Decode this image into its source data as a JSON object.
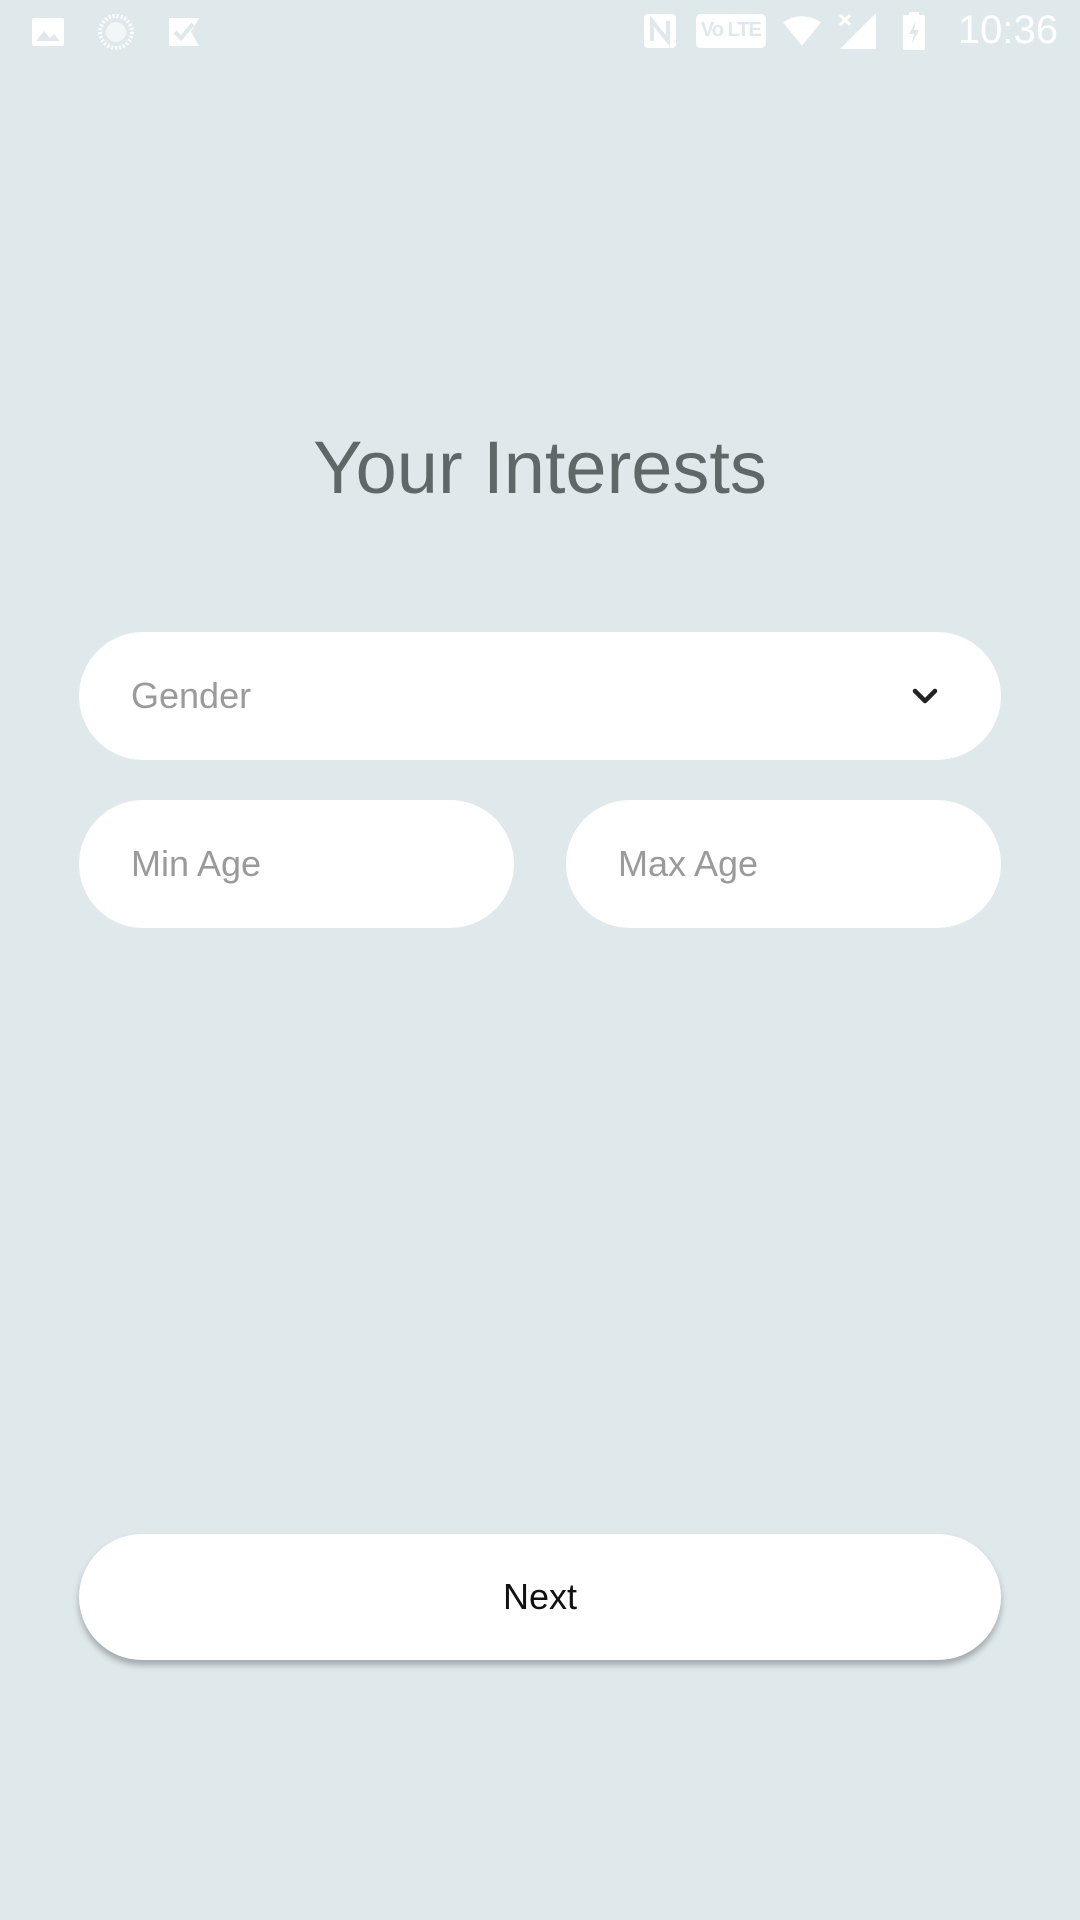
{
  "status_bar": {
    "time": "10:36",
    "network_badge": "Vo LTE",
    "icons": [
      "gallery-icon",
      "sync-icon",
      "tasks-icon",
      "nfc-icon",
      "volte-icon",
      "wifi-icon",
      "signal-icon",
      "battery-icon"
    ]
  },
  "page": {
    "title": "Your Interests"
  },
  "form": {
    "gender": {
      "placeholder": "Gender",
      "icon": "chevron-down-icon"
    },
    "min_age": {
      "placeholder": "Min Age"
    },
    "max_age": {
      "placeholder": "Max Age"
    }
  },
  "actions": {
    "next_label": "Next"
  },
  "colors": {
    "background": "#dfe8eb",
    "card": "#ffffff",
    "title": "#5f6868",
    "placeholder": "#9a9a9a"
  }
}
